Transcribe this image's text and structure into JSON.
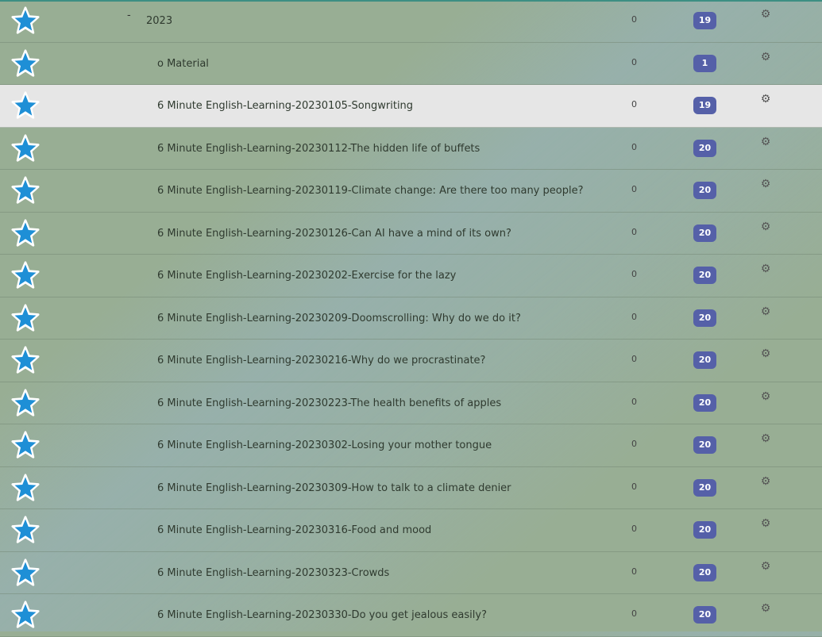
{
  "colors": {
    "badge": "#5560a8",
    "star": "#1e8fd6",
    "row_bg": "#98ae94",
    "selected_row": "#e6e6e6"
  },
  "icons": {
    "favorite": "star-icon",
    "options": "gear-icon"
  },
  "decks": [
    {
      "collapse": "-",
      "name": "2023",
      "due": "0",
      "count": "19",
      "level": 0,
      "selected": false
    },
    {
      "collapse": "",
      "name": "o Material",
      "due": "0",
      "count": "1",
      "level": 1,
      "selected": false
    },
    {
      "collapse": "",
      "name": "6 Minute English-Learning-20230105-Songwriting",
      "due": "0",
      "count": "19",
      "level": 1,
      "selected": true
    },
    {
      "collapse": "",
      "name": "6 Minute English-Learning-20230112-The hidden life of buffets",
      "due": "0",
      "count": "20",
      "level": 1,
      "selected": false
    },
    {
      "collapse": "",
      "name": "6 Minute English-Learning-20230119-Climate change: Are there too many people?",
      "due": "0",
      "count": "20",
      "level": 1,
      "selected": false
    },
    {
      "collapse": "",
      "name": "6 Minute English-Learning-20230126-Can AI have a mind of its own?",
      "due": "0",
      "count": "20",
      "level": 1,
      "selected": false
    },
    {
      "collapse": "",
      "name": "6 Minute English-Learning-20230202-Exercise for the lazy",
      "due": "0",
      "count": "20",
      "level": 1,
      "selected": false
    },
    {
      "collapse": "",
      "name": "6 Minute English-Learning-20230209-Doomscrolling: Why do we do it?",
      "due": "0",
      "count": "20",
      "level": 1,
      "selected": false
    },
    {
      "collapse": "",
      "name": "6 Minute English-Learning-20230216-Why do we procrastinate?",
      "due": "0",
      "count": "20",
      "level": 1,
      "selected": false
    },
    {
      "collapse": "",
      "name": "6 Minute English-Learning-20230223-The health benefits of apples",
      "due": "0",
      "count": "20",
      "level": 1,
      "selected": false
    },
    {
      "collapse": "",
      "name": "6 Minute English-Learning-20230302-Losing your mother tongue",
      "due": "0",
      "count": "20",
      "level": 1,
      "selected": false
    },
    {
      "collapse": "",
      "name": "6 Minute English-Learning-20230309-How to talk to a climate denier",
      "due": "0",
      "count": "20",
      "level": 1,
      "selected": false
    },
    {
      "collapse": "",
      "name": "6 Minute English-Learning-20230316-Food and mood",
      "due": "0",
      "count": "20",
      "level": 1,
      "selected": false
    },
    {
      "collapse": "",
      "name": "6 Minute English-Learning-20230323-Crowds",
      "due": "0",
      "count": "20",
      "level": 1,
      "selected": false
    },
    {
      "collapse": "",
      "name": "6 Minute English-Learning-20230330-Do you get jealous easily?",
      "due": "0",
      "count": "20",
      "level": 1,
      "selected": false
    }
  ]
}
